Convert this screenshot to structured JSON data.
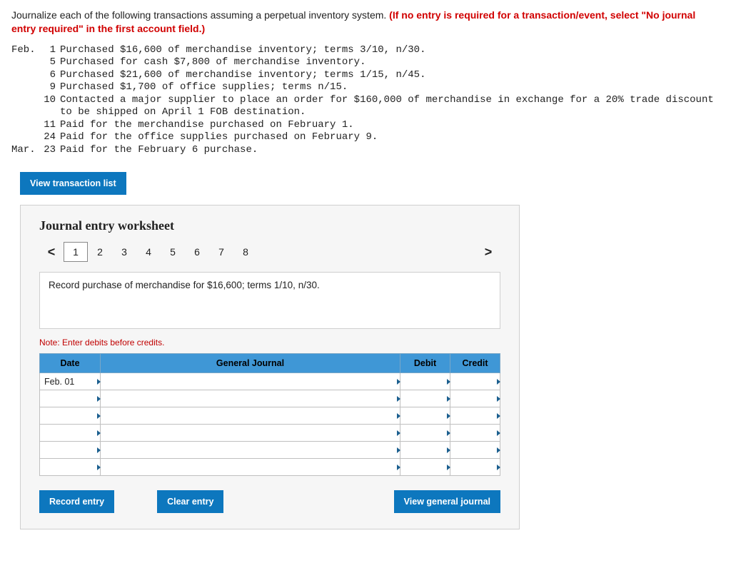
{
  "instructions": {
    "lead": "Journalize each of the following transactions assuming a perpetual inventory system. ",
    "emph": "(If no entry is required for a transaction/event, select \"No journal entry required\" in the first account field.)"
  },
  "transactions": [
    {
      "month": "Feb.",
      "day": "1",
      "desc": "Purchased $16,600 of merchandise inventory; terms 3/10, n/30."
    },
    {
      "month": "",
      "day": "5",
      "desc": "Purchased for cash $7,800 of merchandise inventory."
    },
    {
      "month": "",
      "day": "6",
      "desc": "Purchased $21,600 of merchandise inventory; terms 1/15, n/45."
    },
    {
      "month": "",
      "day": "9",
      "desc": "Purchased $1,700 of office supplies; terms n/15."
    },
    {
      "month": "",
      "day": "10",
      "desc": "Contacted a major supplier to place an order for $160,000 of merchandise in exchange for a 20% trade discount to be shipped on April 1 FOB destination."
    },
    {
      "month": "",
      "day": "11",
      "desc": "Paid for the merchandise purchased on February 1."
    },
    {
      "month": "",
      "day": "24",
      "desc": "Paid for the office supplies purchased on February 9."
    },
    {
      "month": "Mar.",
      "day": "23",
      "desc": "Paid for the February 6 purchase."
    }
  ],
  "buttons": {
    "view_list": "View transaction list",
    "record": "Record entry",
    "clear": "Clear entry",
    "view_gj": "View general journal"
  },
  "worksheet": {
    "title": "Journal entry worksheet",
    "nav_prev": "<",
    "nav_next": ">",
    "steps": [
      "1",
      "2",
      "3",
      "4",
      "5",
      "6",
      "7",
      "8"
    ],
    "active_step": 0,
    "prompt": "Record purchase of merchandise for $16,600; terms 1/10, n/30.",
    "note": "Note: Enter debits before credits.",
    "headers": {
      "date": "Date",
      "gj": "General Journal",
      "debit": "Debit",
      "credit": "Credit"
    },
    "rows": [
      {
        "date": "Feb. 01",
        "gj": "",
        "debit": "",
        "credit": ""
      },
      {
        "date": "",
        "gj": "",
        "debit": "",
        "credit": ""
      },
      {
        "date": "",
        "gj": "",
        "debit": "",
        "credit": ""
      },
      {
        "date": "",
        "gj": "",
        "debit": "",
        "credit": ""
      },
      {
        "date": "",
        "gj": "",
        "debit": "",
        "credit": ""
      },
      {
        "date": "",
        "gj": "",
        "debit": "",
        "credit": ""
      }
    ]
  }
}
